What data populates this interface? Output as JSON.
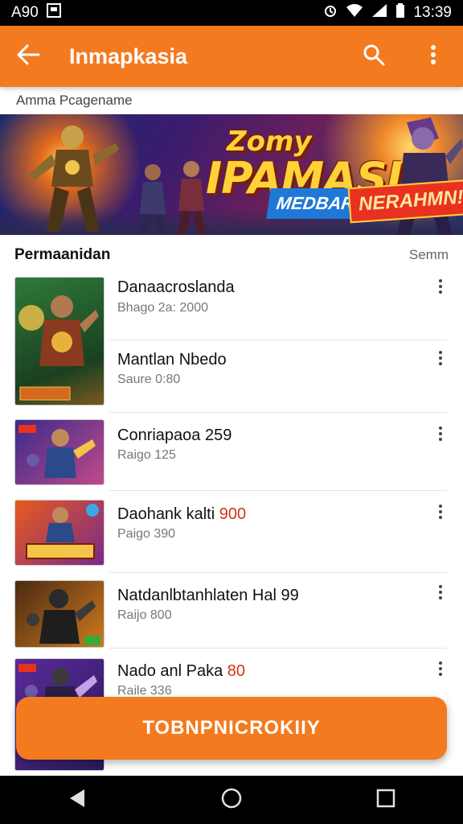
{
  "status_bar": {
    "time_left": "A90",
    "time_right": "13:39"
  },
  "app_bar": {
    "title": "Inmapkasia"
  },
  "subheader": {
    "text": "Amma Pcagename"
  },
  "banner": {
    "headline_line1": "Zomy",
    "headline_line2": "IPAMASI",
    "tag_blue": "MEDBARI",
    "tag_red": "NERAHMN!"
  },
  "section": {
    "title": "Permaanidan",
    "more_label": "Semm"
  },
  "items": [
    {
      "name": "Danaacroslanda",
      "sub": "Bhago 2a: 2000"
    },
    {
      "name": "Mantlan Nbedo",
      "sub": "Saure 0:80"
    },
    {
      "name": "Conriapaoa 259",
      "sub": "Raigo 125"
    },
    {
      "name": "Daohank kalti",
      "name_highlight": "900",
      "sub": "Paigo 390"
    },
    {
      "name": "Natdanlbtanhlaten Hal 99",
      "sub": "Raijo 800"
    },
    {
      "name": "Nado anl Paka",
      "name_highlight": "80",
      "sub": "Raile 336"
    }
  ],
  "cta": {
    "label": "TOBNPNICROKIIY"
  },
  "colors": {
    "accent": "#f47a1f",
    "highlight": "#d2331b",
    "status_bar": "#000000"
  },
  "icons": {
    "back": "arrow-left-icon",
    "search": "search-icon",
    "more": "more-vert-icon",
    "nav_back": "triangle-back-icon",
    "nav_home": "circle-home-icon",
    "nav_recents": "square-recents-icon"
  }
}
